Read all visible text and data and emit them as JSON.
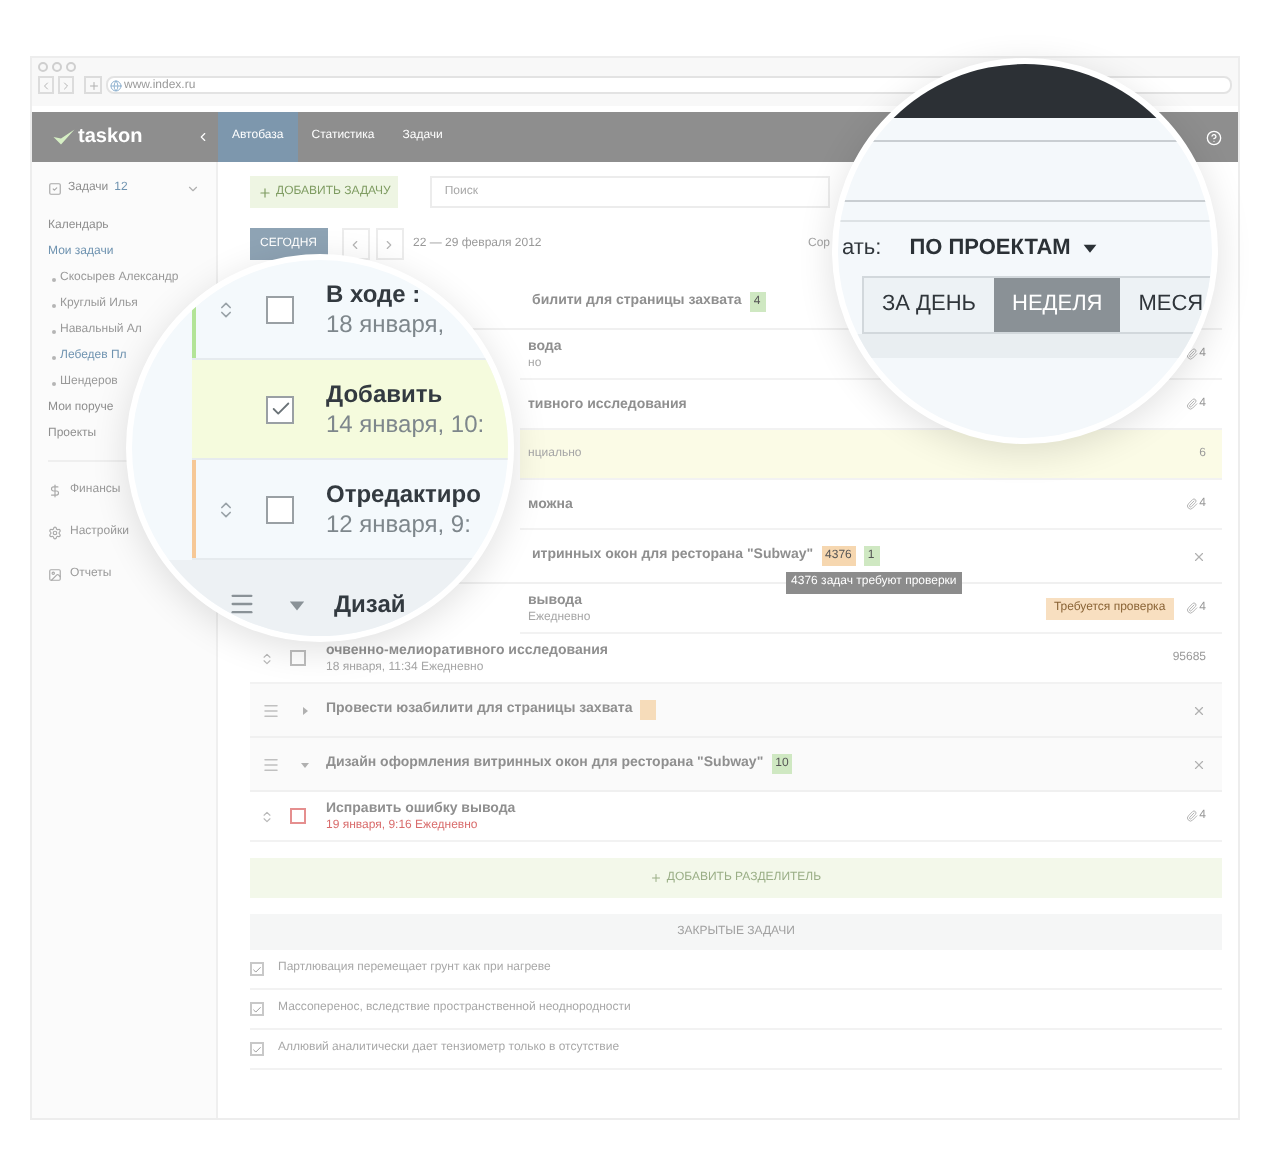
{
  "browser": {
    "url": "www.index.ru"
  },
  "header": {
    "logo": "taskon",
    "nav": [
      {
        "label": "Автобаза",
        "selected": true
      },
      {
        "label": "Статистика",
        "selected": false
      },
      {
        "label": "Задачи",
        "selected": false
      }
    ]
  },
  "sidebar": {
    "tasks": {
      "label": "Задачи",
      "count": "12"
    },
    "items": [
      {
        "label": "Календарь",
        "kind": "link",
        "selected": false
      },
      {
        "label": "Мои задачи",
        "kind": "link",
        "selected": true
      },
      {
        "label": "Скосырев Александр",
        "kind": "sub",
        "selected": false
      },
      {
        "label": "Круглый Илья",
        "kind": "sub",
        "selected": false
      },
      {
        "label": "Навальный Ал",
        "kind": "sub",
        "selected": false
      },
      {
        "label": "Лебедев Пл",
        "kind": "sub",
        "selected": true
      },
      {
        "label": "Шендеров",
        "kind": "sub",
        "selected": false
      },
      {
        "label": "Мои поруче",
        "kind": "link",
        "selected": false
      },
      {
        "label": "Проекты",
        "kind": "link",
        "selected": false
      }
    ],
    "sections": [
      "Финансы",
      "Настройки",
      "Отчеты"
    ]
  },
  "toolbar": {
    "add_task": "ДОБАВИТЬ ЗАДАЧУ",
    "search": {
      "placeholder": "Поиск"
    }
  },
  "datebar": {
    "today": "СЕГОДНЯ",
    "range": "22 — 29 февраля 2012",
    "sort": "Сор"
  },
  "rows": [
    {
      "kind": "group",
      "title": "билити для страницы захвата",
      "badges": [
        {
          "text": "4",
          "color": "#cfe8c2"
        }
      ]
    },
    {
      "kind": "task",
      "title": "вода",
      "date": "но",
      "attachments": "4"
    },
    {
      "kind": "task",
      "title": "тивного исследования",
      "attachments": "4"
    },
    {
      "kind": "task",
      "highlight": true,
      "date": "нциально",
      "counter": "6"
    },
    {
      "kind": "task",
      "title": "можна",
      "attachments": "4"
    },
    {
      "kind": "group",
      "title": "итринных окон для ресторана \"Subway\"",
      "badges": [
        {
          "text": "4376",
          "color": "#f6d7b0"
        },
        {
          "text": "1",
          "color": "#cfe8c2"
        }
      ],
      "tooltip": "4376 задач требуют проверки",
      "closable": true
    },
    {
      "kind": "task",
      "title": "вывода",
      "date": "Ежедневно",
      "status": "Требуется проверка",
      "attachments": "4"
    },
    {
      "kind": "task",
      "checked": false,
      "title": "очвенно-мелиоративного исследования",
      "date": "18 января, 11:34 Ежедневно",
      "counter": "95685"
    },
    {
      "kind": "group",
      "expanded": false,
      "title": "Провести юзабилити для страницы захвата",
      "badges": [
        {
          "color": "#f6dcba"
        }
      ],
      "closable": true
    },
    {
      "kind": "group",
      "expanded": true,
      "title": "Дизайн оформления витринных окон для ресторана \"Subway\"",
      "badges": [
        {
          "text": "10",
          "color": "#cfe8c2"
        }
      ],
      "closable": true
    },
    {
      "kind": "task",
      "checked": false,
      "overdue": true,
      "title": "Исправить ошибку вывода",
      "date": "19 января, 9:16 Ежедневно",
      "attachments": "4"
    }
  ],
  "add_divider": "ДОБАВИТЬ РАЗДЕЛИТЕЛЬ",
  "closed": {
    "title": "ЗАКРЫТЫЕ ЗАДАЧИ",
    "items": [
      {
        "text": "Партлювация перемещает грунт как при нагреве",
        "checked": true
      },
      {
        "text": "Массоперенос, вследствие пространственной неоднородности",
        "checked": true
      },
      {
        "text": "Аллювий аналитически дает тензиометр только в отсутствие",
        "checked": true
      }
    ]
  },
  "magnifier_left": {
    "rows": [
      {
        "title": "В ходе :",
        "date": "18 января,",
        "checked": false,
        "color": "#b3e497"
      },
      {
        "title": "Добавить",
        "date": "14 января, 10:",
        "checked": true,
        "highlight": true
      },
      {
        "title": "Отредактиро",
        "date": "12 января, 9:",
        "checked": false,
        "color": "#f6c896"
      }
    ],
    "group": {
      "title": "Дизай",
      "expanded": true
    }
  },
  "magnifier_right": {
    "sort_label": "ать:",
    "sort_value": "ПО ПРОЕКТАМ",
    "periods": [
      {
        "label": "ЗА ДЕНЬ",
        "selected": false
      },
      {
        "label": "НЕДЕЛЯ",
        "selected": true
      },
      {
        "label": "МЕСЯ",
        "selected": false
      }
    ]
  }
}
